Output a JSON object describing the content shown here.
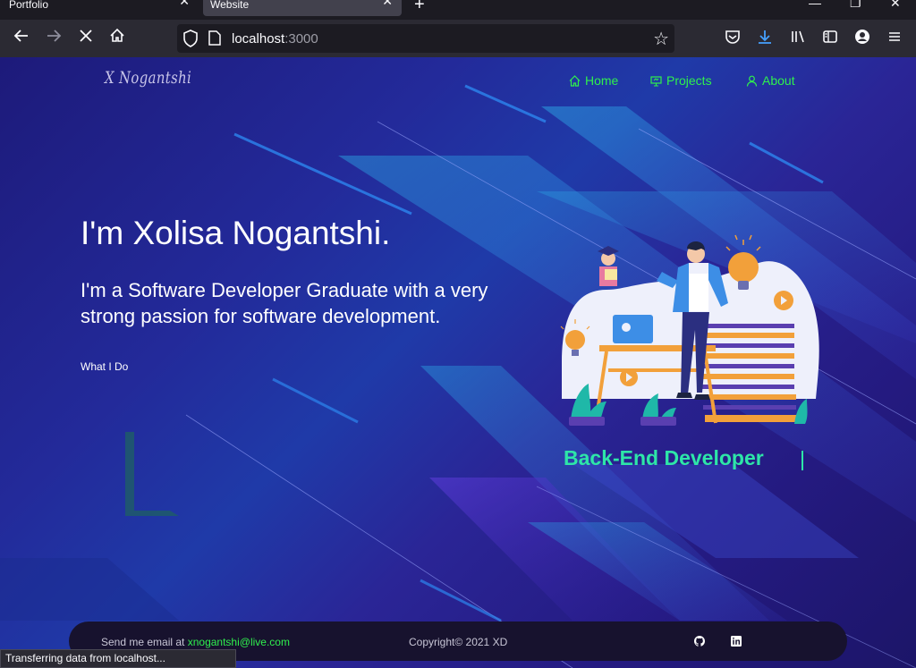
{
  "browser": {
    "tabs": [
      {
        "title": "Portfolio",
        "active": false
      },
      {
        "title": "Website",
        "active": true
      }
    ],
    "url_host": "localhost",
    "url_port": ":3000",
    "status_text": "Transferring data from localhost..."
  },
  "site": {
    "logo": "X Nogantshi",
    "nav": [
      {
        "label": "Home",
        "icon": "home-icon"
      },
      {
        "label": "Projects",
        "icon": "projects-icon"
      },
      {
        "label": "About",
        "icon": "user-icon"
      }
    ],
    "hero": {
      "title": "I'm Xolisa Nogantshi.",
      "subtitle": "I'm a Software Developer Graduate with a very strong passion for software development.",
      "link": "What I Do"
    },
    "role": "Back-End Developer",
    "footer": {
      "email_prefix": "Send me email at ",
      "email": "xnogantshi@live.com",
      "copyright": "Copyright© 2021 XD",
      "icons": [
        "github-icon",
        "linkedin-icon"
      ]
    },
    "colors": {
      "accent_green": "#2ff04d",
      "role_teal": "#2ee6a8",
      "footer_bg": "#17122e"
    }
  }
}
